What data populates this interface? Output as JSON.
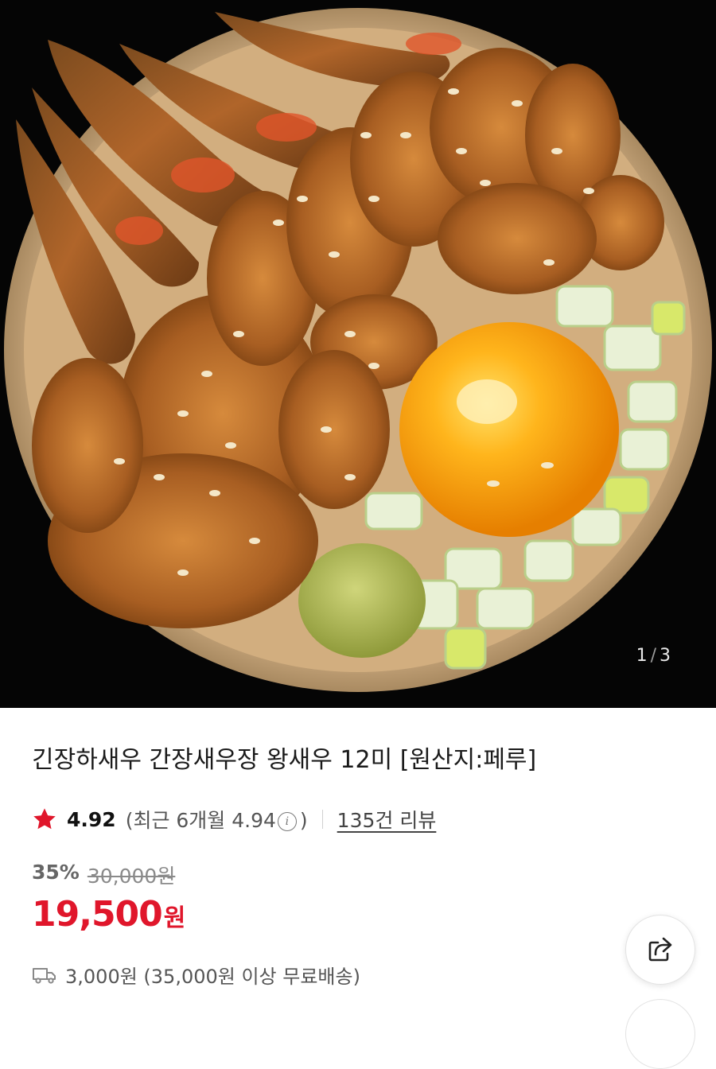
{
  "gallery": {
    "current": "1",
    "separator": "/",
    "total": "3",
    "image_icon": "product-photo"
  },
  "product": {
    "title": "긴장하새우 간장새우장 왕새우 12미 [원산지:페루]"
  },
  "rating": {
    "star_icon": "star-icon",
    "score": "4.92",
    "recent_prefix": "(최근 6개월 4.94",
    "info_icon": "i",
    "recent_suffix": ")",
    "review_count": "135건 리뷰"
  },
  "price": {
    "discount": "35%",
    "original": "30,000원",
    "sale_number": "19,500",
    "sale_unit": "원",
    "accent_color": "#e0162b"
  },
  "shipping": {
    "icon": "truck-icon",
    "text": "3,000원 (35,000원 이상 무료배송)"
  },
  "actions": {
    "share_icon": "share-icon"
  }
}
